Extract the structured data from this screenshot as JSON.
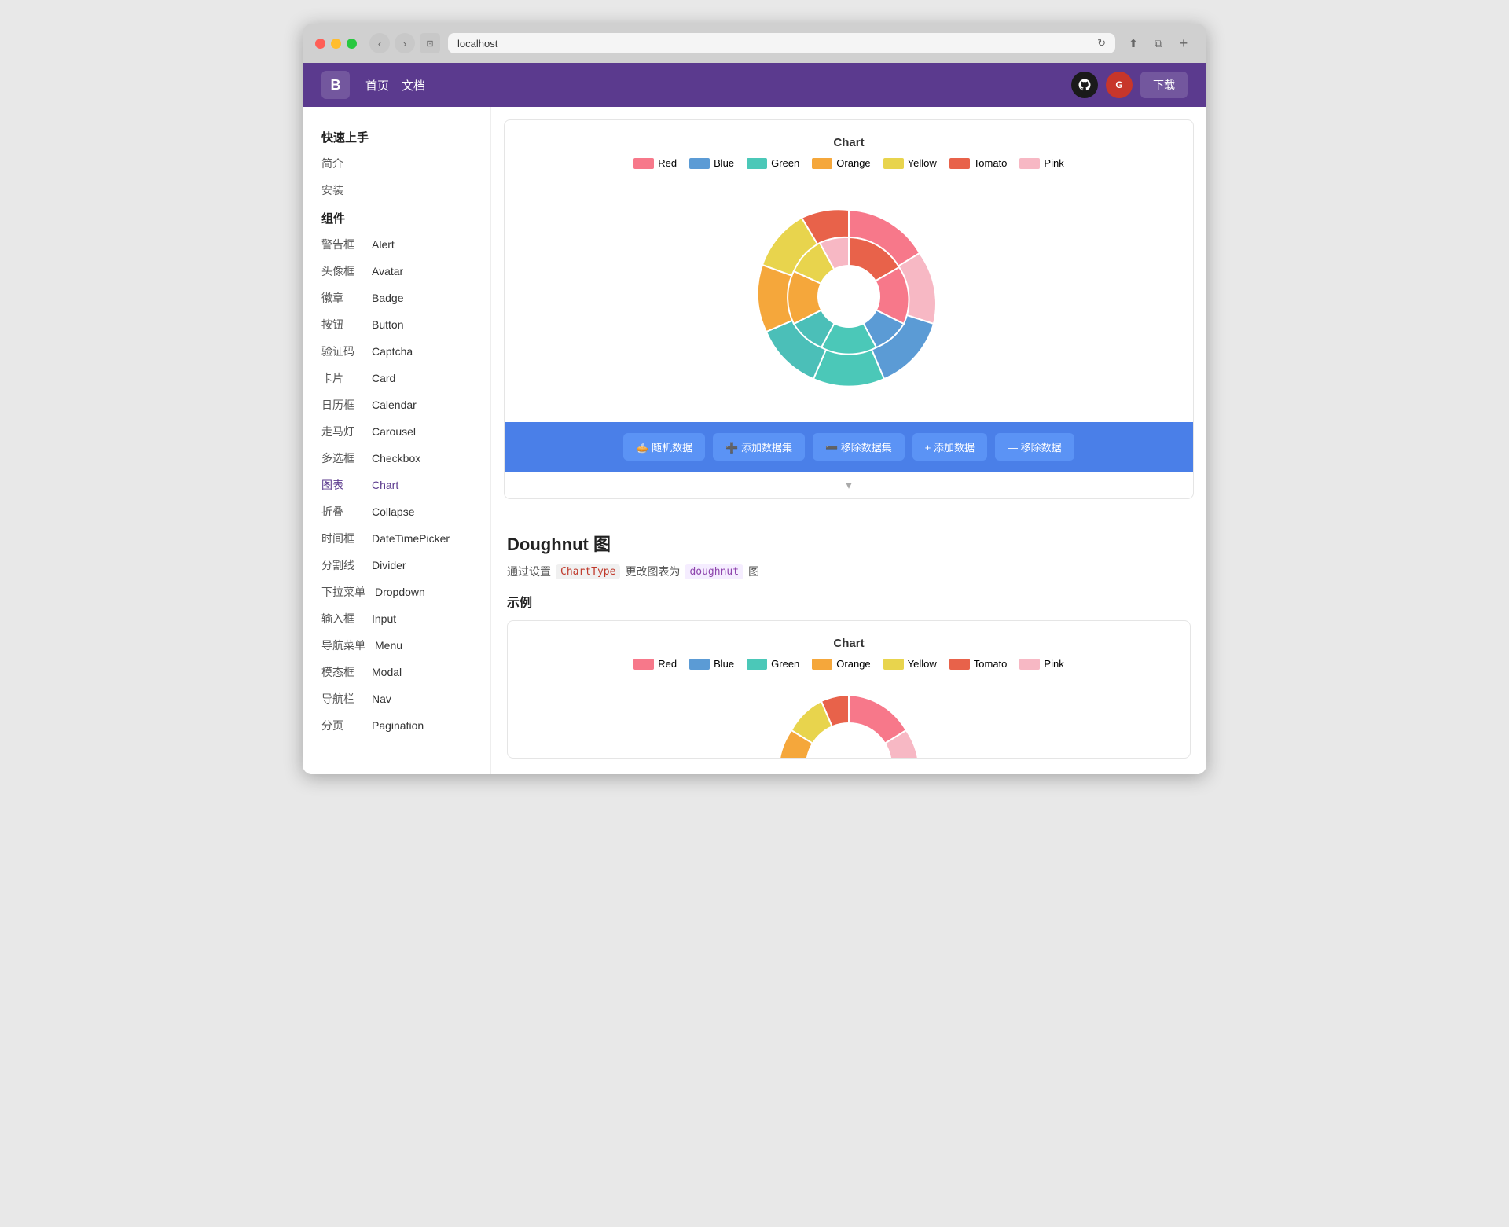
{
  "browser": {
    "url": "localhost"
  },
  "header": {
    "brand": "B",
    "nav": [
      "首页",
      "文档"
    ],
    "download_label": "下载"
  },
  "sidebar": {
    "section1_title": "快速上手",
    "quick_items": [
      {
        "zh": "简介",
        "en": ""
      },
      {
        "zh": "安装",
        "en": ""
      }
    ],
    "section2_title": "组件",
    "components": [
      {
        "zh": "警告框",
        "en": "Alert",
        "active": false
      },
      {
        "zh": "头像框",
        "en": "Avatar",
        "active": false
      },
      {
        "zh": "徽章",
        "en": "Badge",
        "active": false
      },
      {
        "zh": "按钮",
        "en": "Button",
        "active": false
      },
      {
        "zh": "验证码",
        "en": "Captcha",
        "active": false
      },
      {
        "zh": "卡片",
        "en": "Card",
        "active": false
      },
      {
        "zh": "日历框",
        "en": "Calendar",
        "active": false
      },
      {
        "zh": "走马灯",
        "en": "Carousel",
        "active": false
      },
      {
        "zh": "多选框",
        "en": "Checkbox",
        "active": false
      },
      {
        "zh": "图表",
        "en": "Chart",
        "active": true
      },
      {
        "zh": "折叠",
        "en": "Collapse",
        "active": false
      },
      {
        "zh": "时间框",
        "en": "DateTimePicker",
        "active": false
      },
      {
        "zh": "分割线",
        "en": "Divider",
        "active": false
      },
      {
        "zh": "下拉菜单",
        "en": "Dropdown",
        "active": false
      },
      {
        "zh": "输入框",
        "en": "Input",
        "active": false
      },
      {
        "zh": "导航菜单",
        "en": "Menu",
        "active": false
      },
      {
        "zh": "模态框",
        "en": "Modal",
        "active": false
      },
      {
        "zh": "导航栏",
        "en": "Nav",
        "active": false
      },
      {
        "zh": "分页",
        "en": "Pagination",
        "active": false
      }
    ]
  },
  "chart_section": {
    "title": "Chart",
    "legend": [
      {
        "label": "Red",
        "color": "#f7788a"
      },
      {
        "label": "Blue",
        "color": "#5b9bd5"
      },
      {
        "label": "Green",
        "color": "#4bc8b8"
      },
      {
        "label": "Orange",
        "color": "#f5a73b"
      },
      {
        "label": "Yellow",
        "color": "#e8d44d"
      },
      {
        "label": "Tomato",
        "color": "#e8624a"
      },
      {
        "label": "Pink",
        "color": "#f7b8c4"
      }
    ],
    "buttons": [
      {
        "icon": "🥧",
        "label": "随机数据"
      },
      {
        "icon": "➕",
        "label": "添加数据集"
      },
      {
        "icon": "➖",
        "label": "移除数据集"
      },
      {
        "icon": "+",
        "label": "添加数据"
      },
      {
        "icon": "—",
        "label": "移除数据"
      }
    ]
  },
  "doughnut_section": {
    "title": "Doughnut 图",
    "desc_prefix": "通过设置",
    "chart_type_tag": "ChartType",
    "desc_mid": "更改图表为",
    "doughnut_tag": "doughnut",
    "desc_suffix": "图",
    "example_label": "示例",
    "chart2_title": "Chart",
    "legend2": [
      {
        "label": "Red",
        "color": "#f7788a"
      },
      {
        "label": "Blue",
        "color": "#5b9bd5"
      },
      {
        "label": "Green",
        "color": "#4bc8b8"
      },
      {
        "label": "Orange",
        "color": "#f5a73b"
      },
      {
        "label": "Yellow",
        "color": "#e8d44d"
      },
      {
        "label": "Tomato",
        "color": "#e8624a"
      },
      {
        "label": "Pink",
        "color": "#f7b8c4"
      }
    ]
  }
}
